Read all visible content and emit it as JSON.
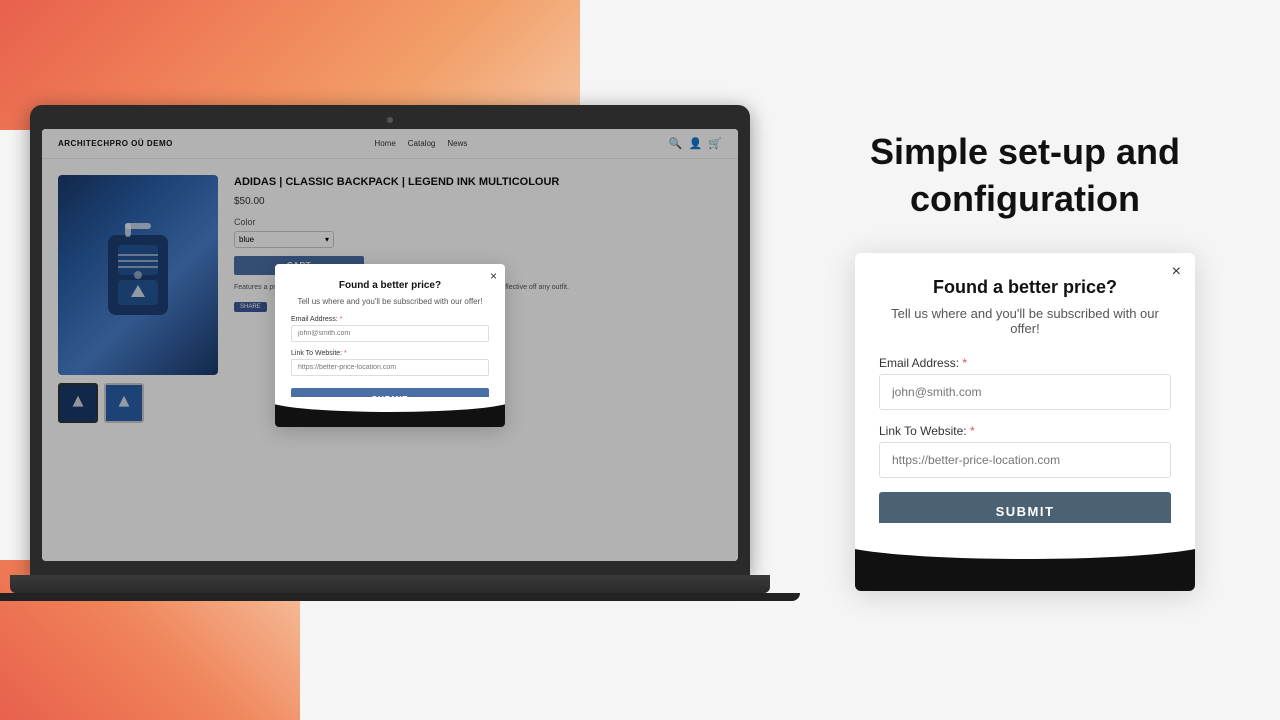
{
  "background": {
    "top_left_gradient": "coral-to-peach",
    "bottom_left_gradient": "coral-to-peach"
  },
  "laptop": {
    "store": {
      "brand": "ARCHITECHPRO OÜ DEMO",
      "nav": [
        "Home",
        "Catalog",
        "News"
      ],
      "product": {
        "title": "ADIDAS | CLASSIC BACKPACK | LEGEND INK MULTICOLOUR",
        "price": "$50.00",
        "color_label": "Color",
        "color_value": "blue",
        "add_to_cart": "CART",
        "description": "Features a pre-curved brim to keep\nand-loop adjustable closure\n3-Stripes design and reflective\noff any outfit."
      },
      "modal": {
        "title": "Found a better price?",
        "subtitle": "Tell us where and you'll be subscribed with our offer!",
        "email_label": "Email Address:",
        "email_placeholder": "john@smith.com",
        "link_label": "Link To Website:",
        "link_placeholder": "https://better-price-location.com",
        "submit_label": "SUBMIT",
        "close_icon": "×"
      }
    }
  },
  "right_panel": {
    "tagline": "Simple set-up and\nconfiguration",
    "modal_preview": {
      "title": "Found a better price?",
      "subtitle": "Tell us where and you'll be subscribed with our offer!",
      "email_label": "Email Address:",
      "email_placeholder": "john@smith.com",
      "link_label": "Link To Website:",
      "link_placeholder": "https://better-price-location.com",
      "submit_label": "SUBMIT",
      "close_icon": "×"
    }
  }
}
